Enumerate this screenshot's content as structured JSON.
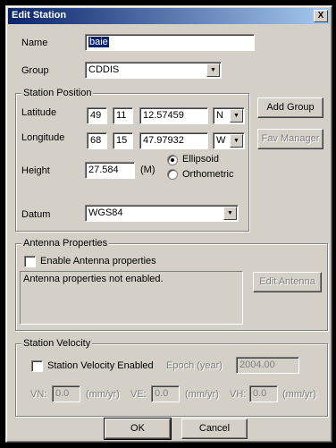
{
  "window": {
    "title": "Edit Station",
    "close_glyph": "X"
  },
  "name": {
    "label": "Name",
    "value": "baie"
  },
  "group": {
    "label": "Group",
    "value": "CDDIS"
  },
  "station_position": {
    "legend": "Station Position",
    "latitude": {
      "label": "Latitude",
      "deg": "49",
      "min": "11",
      "sec": "12.57459",
      "hemisphere": "N"
    },
    "longitude": {
      "label": "Longitude",
      "deg": "68",
      "min": "15",
      "sec": "47.97932",
      "hemisphere": "W"
    },
    "height": {
      "label": "Height",
      "value": "27.584",
      "unit": "(M)"
    },
    "height_ref": {
      "ellipsoid": "Ellipsoid",
      "orthometric": "Orthometric",
      "selected": "Ellipsoid"
    },
    "datum": {
      "label": "Datum",
      "value": "WGS84"
    }
  },
  "buttons": {
    "add_group": "Add Group",
    "fav_manager": "Fav Manager",
    "edit_antenna": "Edit Antenna",
    "ok": "OK",
    "cancel": "Cancel"
  },
  "antenna": {
    "legend": "Antenna Properties",
    "enable_label": "Enable Antenna properties",
    "enabled": false,
    "status": "Antenna properties not enabled."
  },
  "velocity": {
    "legend": "Station Velocity",
    "enabled_label": "Station Velocity Enabled",
    "enabled": false,
    "epoch_label": "Epoch (year)",
    "epoch_value": "2004.00",
    "vn_label": "VN:",
    "vn_value": "0.0",
    "ve_label": "VE:",
    "ve_value": "0.0",
    "vh_label": "VH:",
    "vh_value": "0.0",
    "unit": "(mm/yr)"
  },
  "icons": {
    "dropdown": "chevron-down-icon",
    "close": "close-icon"
  }
}
